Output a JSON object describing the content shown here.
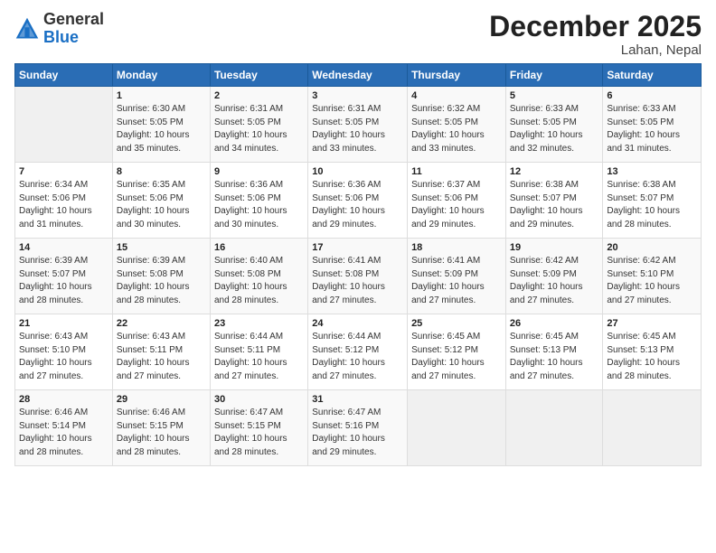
{
  "header": {
    "logo_general": "General",
    "logo_blue": "Blue",
    "month_year": "December 2025",
    "location": "Lahan, Nepal"
  },
  "calendar": {
    "days_of_week": [
      "Sunday",
      "Monday",
      "Tuesday",
      "Wednesday",
      "Thursday",
      "Friday",
      "Saturday"
    ],
    "weeks": [
      [
        {
          "day": "",
          "info": ""
        },
        {
          "day": "1",
          "info": "Sunrise: 6:30 AM\nSunset: 5:05 PM\nDaylight: 10 hours\nand 35 minutes."
        },
        {
          "day": "2",
          "info": "Sunrise: 6:31 AM\nSunset: 5:05 PM\nDaylight: 10 hours\nand 34 minutes."
        },
        {
          "day": "3",
          "info": "Sunrise: 6:31 AM\nSunset: 5:05 PM\nDaylight: 10 hours\nand 33 minutes."
        },
        {
          "day": "4",
          "info": "Sunrise: 6:32 AM\nSunset: 5:05 PM\nDaylight: 10 hours\nand 33 minutes."
        },
        {
          "day": "5",
          "info": "Sunrise: 6:33 AM\nSunset: 5:05 PM\nDaylight: 10 hours\nand 32 minutes."
        },
        {
          "day": "6",
          "info": "Sunrise: 6:33 AM\nSunset: 5:05 PM\nDaylight: 10 hours\nand 31 minutes."
        }
      ],
      [
        {
          "day": "7",
          "info": "Sunrise: 6:34 AM\nSunset: 5:06 PM\nDaylight: 10 hours\nand 31 minutes."
        },
        {
          "day": "8",
          "info": "Sunrise: 6:35 AM\nSunset: 5:06 PM\nDaylight: 10 hours\nand 30 minutes."
        },
        {
          "day": "9",
          "info": "Sunrise: 6:36 AM\nSunset: 5:06 PM\nDaylight: 10 hours\nand 30 minutes."
        },
        {
          "day": "10",
          "info": "Sunrise: 6:36 AM\nSunset: 5:06 PM\nDaylight: 10 hours\nand 29 minutes."
        },
        {
          "day": "11",
          "info": "Sunrise: 6:37 AM\nSunset: 5:06 PM\nDaylight: 10 hours\nand 29 minutes."
        },
        {
          "day": "12",
          "info": "Sunrise: 6:38 AM\nSunset: 5:07 PM\nDaylight: 10 hours\nand 29 minutes."
        },
        {
          "day": "13",
          "info": "Sunrise: 6:38 AM\nSunset: 5:07 PM\nDaylight: 10 hours\nand 28 minutes."
        }
      ],
      [
        {
          "day": "14",
          "info": "Sunrise: 6:39 AM\nSunset: 5:07 PM\nDaylight: 10 hours\nand 28 minutes."
        },
        {
          "day": "15",
          "info": "Sunrise: 6:39 AM\nSunset: 5:08 PM\nDaylight: 10 hours\nand 28 minutes."
        },
        {
          "day": "16",
          "info": "Sunrise: 6:40 AM\nSunset: 5:08 PM\nDaylight: 10 hours\nand 28 minutes."
        },
        {
          "day": "17",
          "info": "Sunrise: 6:41 AM\nSunset: 5:08 PM\nDaylight: 10 hours\nand 27 minutes."
        },
        {
          "day": "18",
          "info": "Sunrise: 6:41 AM\nSunset: 5:09 PM\nDaylight: 10 hours\nand 27 minutes."
        },
        {
          "day": "19",
          "info": "Sunrise: 6:42 AM\nSunset: 5:09 PM\nDaylight: 10 hours\nand 27 minutes."
        },
        {
          "day": "20",
          "info": "Sunrise: 6:42 AM\nSunset: 5:10 PM\nDaylight: 10 hours\nand 27 minutes."
        }
      ],
      [
        {
          "day": "21",
          "info": "Sunrise: 6:43 AM\nSunset: 5:10 PM\nDaylight: 10 hours\nand 27 minutes."
        },
        {
          "day": "22",
          "info": "Sunrise: 6:43 AM\nSunset: 5:11 PM\nDaylight: 10 hours\nand 27 minutes."
        },
        {
          "day": "23",
          "info": "Sunrise: 6:44 AM\nSunset: 5:11 PM\nDaylight: 10 hours\nand 27 minutes."
        },
        {
          "day": "24",
          "info": "Sunrise: 6:44 AM\nSunset: 5:12 PM\nDaylight: 10 hours\nand 27 minutes."
        },
        {
          "day": "25",
          "info": "Sunrise: 6:45 AM\nSunset: 5:12 PM\nDaylight: 10 hours\nand 27 minutes."
        },
        {
          "day": "26",
          "info": "Sunrise: 6:45 AM\nSunset: 5:13 PM\nDaylight: 10 hours\nand 27 minutes."
        },
        {
          "day": "27",
          "info": "Sunrise: 6:45 AM\nSunset: 5:13 PM\nDaylight: 10 hours\nand 28 minutes."
        }
      ],
      [
        {
          "day": "28",
          "info": "Sunrise: 6:46 AM\nSunset: 5:14 PM\nDaylight: 10 hours\nand 28 minutes."
        },
        {
          "day": "29",
          "info": "Sunrise: 6:46 AM\nSunset: 5:15 PM\nDaylight: 10 hours\nand 28 minutes."
        },
        {
          "day": "30",
          "info": "Sunrise: 6:47 AM\nSunset: 5:15 PM\nDaylight: 10 hours\nand 28 minutes."
        },
        {
          "day": "31",
          "info": "Sunrise: 6:47 AM\nSunset: 5:16 PM\nDaylight: 10 hours\nand 29 minutes."
        },
        {
          "day": "",
          "info": ""
        },
        {
          "day": "",
          "info": ""
        },
        {
          "day": "",
          "info": ""
        }
      ]
    ]
  }
}
